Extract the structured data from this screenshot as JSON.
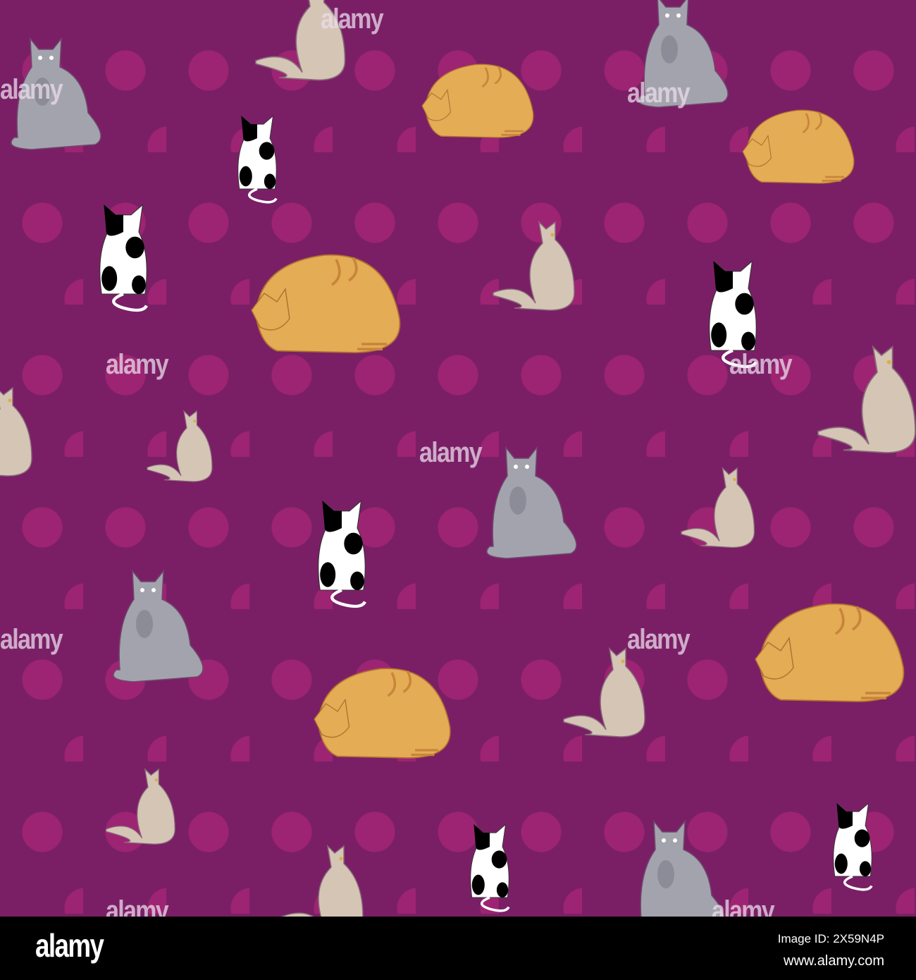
{
  "pattern": {
    "background_color": "#7a1f66",
    "dot_color": "#9d2472",
    "cat_types": [
      "grey-sitting-cat",
      "beige-sitting-cat",
      "orange-sleeping-cat",
      "black-white-cat"
    ]
  },
  "watermark": "alamy",
  "footer": {
    "logo": "alamy",
    "image_id": "Image ID: 2X59N4P",
    "url": "www.alamy.com"
  }
}
